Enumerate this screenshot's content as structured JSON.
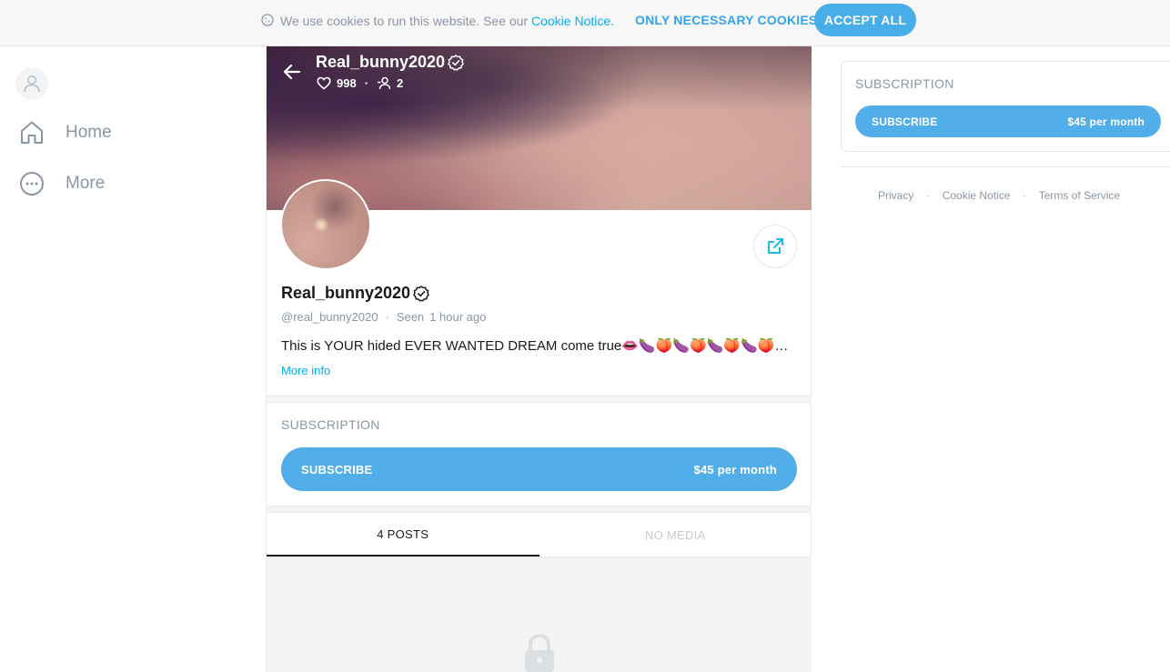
{
  "cookie_bar": {
    "text": "We use cookies to run this website. See our ",
    "link": "Cookie Notice",
    "link_suffix": ".",
    "necessary_label": "ONLY NECESSARY COOKIES",
    "accept_label": "ACCEPT ALL"
  },
  "sidebar": {
    "items": [
      {
        "label": "Home",
        "icon": "home-icon"
      },
      {
        "label": "More",
        "icon": "more-icon"
      }
    ]
  },
  "profile": {
    "name": "Real_bunny2020",
    "likes": "998",
    "fans": "2",
    "handle": "@real_bunny2020",
    "seen_label": "Seen",
    "seen_time": "1 hour ago",
    "bio": "This is YOUR hided EVER WANTED DREAM come true👄🍆🍑🍆🍑🍆🍑🍆🍑🍆🍑🍆",
    "more_info": "More info"
  },
  "subscription": {
    "title": "SUBSCRIPTION",
    "button_label": "SUBSCRIBE",
    "price": "$45 per month"
  },
  "tabs": [
    {
      "label": "4 POSTS",
      "active": true
    },
    {
      "label": "NO MEDIA",
      "active": false
    }
  ],
  "right": {
    "title": "SUBSCRIPTION",
    "button_label": "SUBSCRIBE",
    "price": "$45 per month",
    "footer": [
      "Privacy",
      "Cookie Notice",
      "Terms of Service"
    ],
    "separator": "·"
  },
  "colors": {
    "accent": "#00aff0",
    "button": "#52aee9",
    "muted": "#8a96a3"
  }
}
